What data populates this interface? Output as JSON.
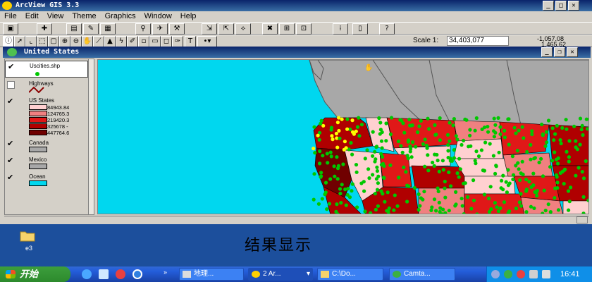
{
  "window": {
    "title": "ArcView GIS 3.3"
  },
  "menu": [
    "File",
    "Edit",
    "View",
    "Theme",
    "Graphics",
    "Window",
    "Help"
  ],
  "toolbar": {
    "scale_label": "Scale 1:",
    "scale_value": "34,403,077",
    "coord_x": "-1,057.08",
    "coord_y": "1,465.62"
  },
  "view": {
    "title": "United States"
  },
  "legend": {
    "layers": [
      {
        "name": "Uscities.shp",
        "checked": true
      },
      {
        "name": "Highways",
        "checked": false
      },
      {
        "name": "US States",
        "checked": true,
        "classes": [
          "84943.84",
          "124765.3",
          "219420.3",
          "325678 -",
          "447764.6"
        ],
        "colors": [
          "#ffd0d0",
          "#f08080",
          "#e01818",
          "#b00000",
          "#700000"
        ]
      },
      {
        "name": "Canada",
        "checked": true,
        "color": "#a8a8a8"
      },
      {
        "name": "Mexico",
        "checked": true,
        "color": "#a8a8a8"
      },
      {
        "name": "Ocean",
        "checked": true,
        "color": "#00d7ef"
      }
    ],
    "city_color": "#00c800",
    "highway_color": "#8b0000"
  },
  "desktop": {
    "caption": "结果显示",
    "icon_label": "e3"
  },
  "taskbar": {
    "start": "开始",
    "tasks": [
      "地理...",
      "2 Ar...",
      "C:\\Do...",
      "Camta..."
    ],
    "clock": "16:41"
  }
}
